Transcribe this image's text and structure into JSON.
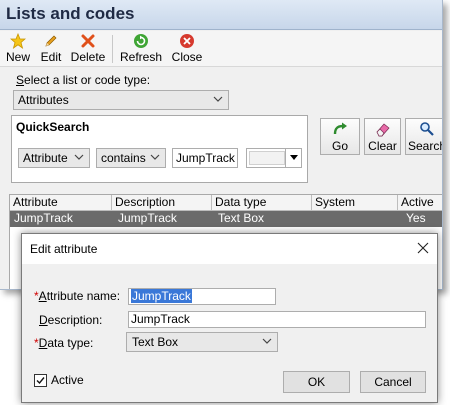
{
  "window": {
    "title": "Lists and codes"
  },
  "toolbar": {
    "new_label": "New",
    "edit_label": "Edit",
    "delete_label": "Delete",
    "refresh_label": "Refresh",
    "close_label": "Close"
  },
  "type_select": {
    "label": "Select a list or code type:",
    "label_underlined_char": "S",
    "label_rest": "elect a list or code type:",
    "value": "Attributes"
  },
  "quicksearch": {
    "title": "QuickSearch",
    "field": "Attribute",
    "operator": "contains",
    "value": "JumpTrack"
  },
  "actions": {
    "go": "Go",
    "clear": "Clear",
    "search": "Search"
  },
  "grid": {
    "columns": [
      "Attribute",
      "Description",
      "Data type",
      "System",
      "Active"
    ],
    "rows": [
      {
        "attribute": "JumpTrack",
        "description": "JumpTrack",
        "data_type": "Text Box",
        "system": "",
        "active": "Yes"
      }
    ]
  },
  "dialog": {
    "title": "Edit attribute",
    "name_label_prefix": "*",
    "name_label_u": "A",
    "name_label_rest": "ttribute name:",
    "name_value": "JumpTrack",
    "desc_label_u": "D",
    "desc_label_rest": "escription:",
    "desc_value": "JumpTrack",
    "type_label_prefix": "*",
    "type_label_u": "D",
    "type_label_rest": "ata type:",
    "type_value": "Text Box",
    "active_label": "Active",
    "active_checked": true,
    "ok_label": "OK",
    "cancel_label": "Cancel"
  },
  "colors": {
    "required": "#d00000",
    "selection": "#3a78d8",
    "grid_selected_row": "#6b6b6b",
    "title_text": "#1f2a44"
  },
  "icons": [
    "star-icon",
    "pencil-icon",
    "delete-x-icon",
    "refresh-icon",
    "close-circle-icon",
    "go-arrow-icon",
    "eraser-icon",
    "magnifier-icon",
    "chevron-down-icon",
    "close-icon",
    "checkmark-icon"
  ]
}
